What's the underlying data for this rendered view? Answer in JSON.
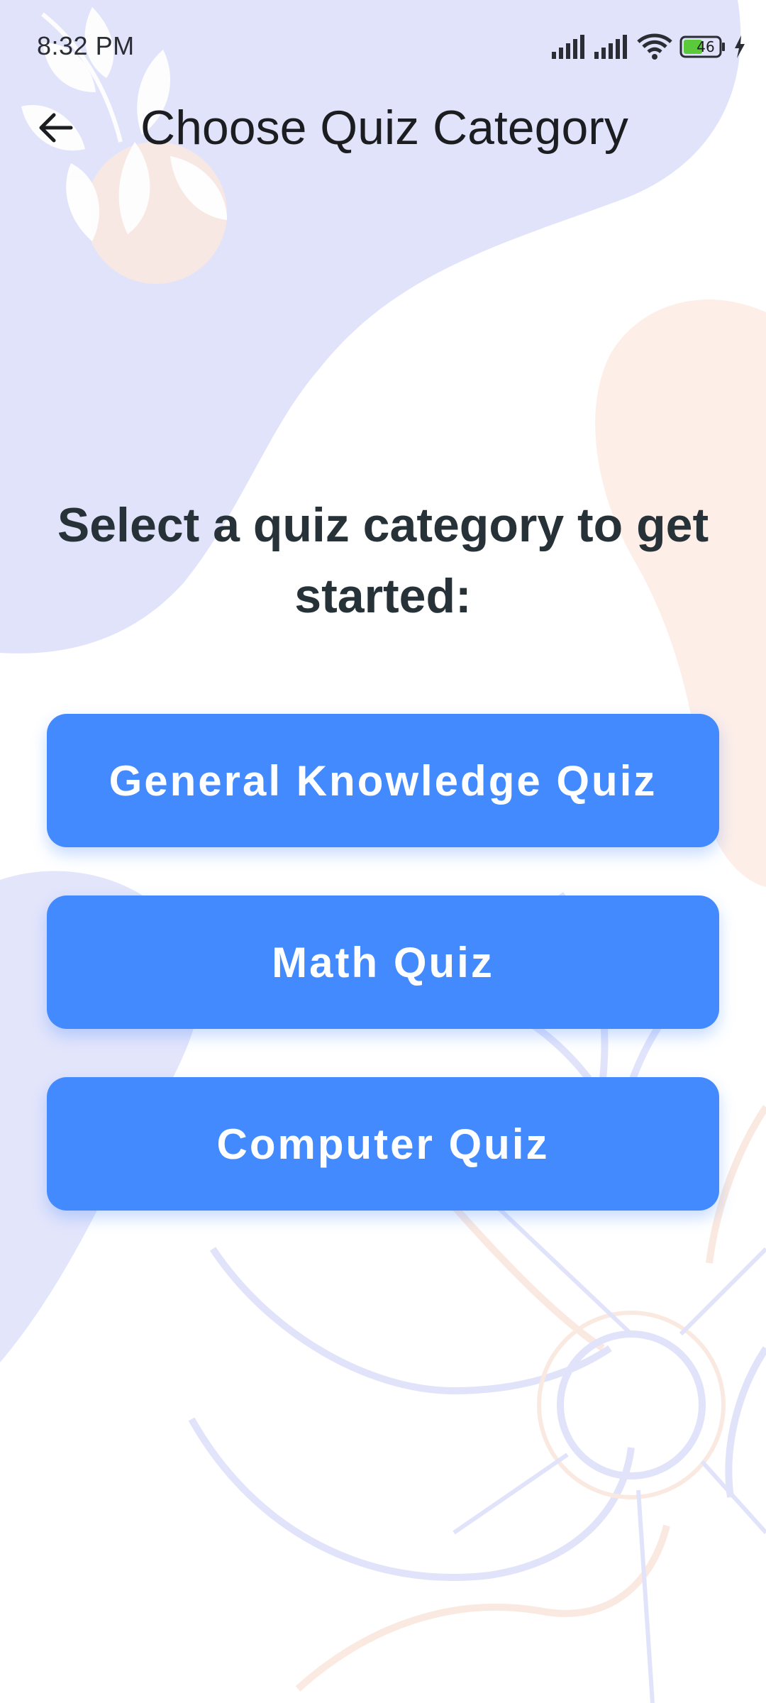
{
  "status_bar": {
    "time": "8:32 PM",
    "battery_level": "46",
    "icons": [
      "signal-icon",
      "signal-icon",
      "wifi-icon",
      "battery-icon",
      "charging-bolt-icon"
    ]
  },
  "app_bar": {
    "back_icon": "arrow-left-icon",
    "title": "Choose Quiz Category"
  },
  "main": {
    "prompt": "Select a quiz category to get started:",
    "categories": [
      {
        "label": "General Knowledge Quiz"
      },
      {
        "label": "Math Quiz"
      },
      {
        "label": "Computer Quiz"
      }
    ]
  },
  "colors": {
    "button_blue": "#448aff",
    "heading_text": "#263238",
    "blob_lavender": "#e1e3fb",
    "blob_peach": "#fdeee6"
  }
}
